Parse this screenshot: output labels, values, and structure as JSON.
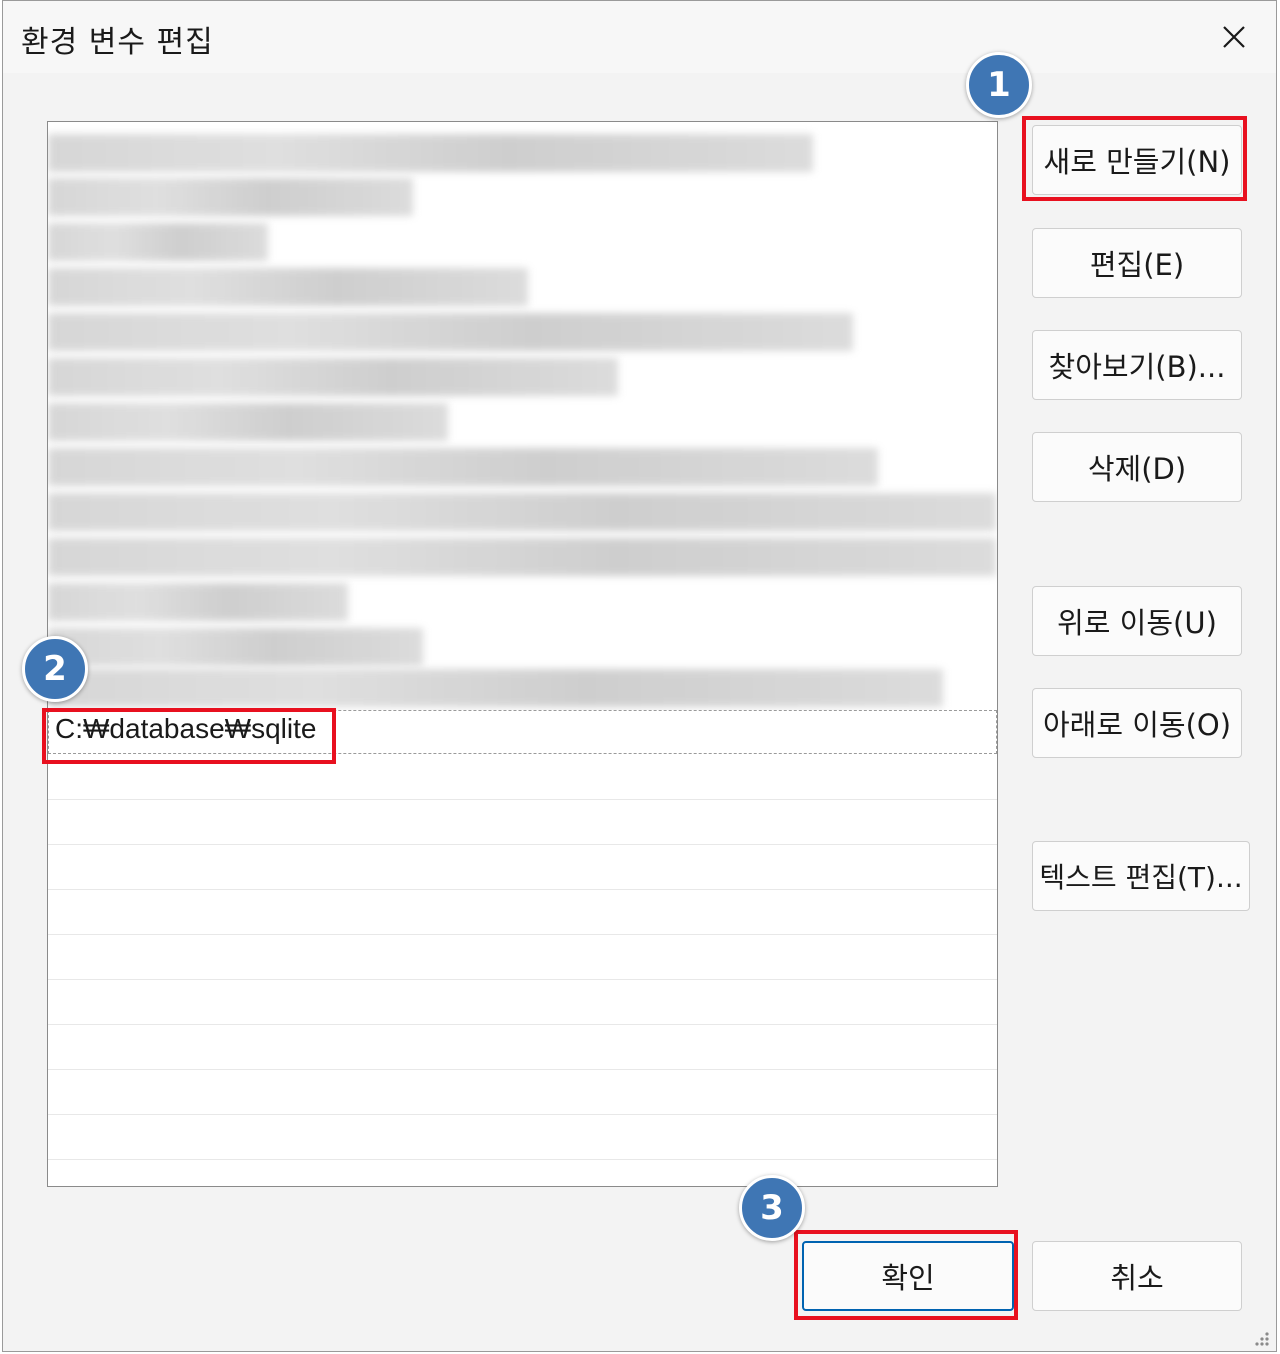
{
  "window": {
    "title": "환경 변수 편집"
  },
  "list": {
    "selected_value": "C:₩database₩sqlite"
  },
  "buttons": {
    "new": "새로 만들기(N)",
    "edit": "편집(E)",
    "browse": "찾아보기(B)...",
    "delete": "삭제(D)",
    "move_up": "위로 이동(U)",
    "move_down": "아래로 이동(O)",
    "edit_text": "텍스트 편집(T)...",
    "ok": "확인",
    "cancel": "취소"
  },
  "annotations": {
    "step1": "1",
    "step2": "2",
    "step3": "3",
    "highlight_color": "#e8101f",
    "badge_color": "#3f76b4"
  },
  "icons": {
    "close": "close-icon",
    "resize": "resize-grip-icon"
  }
}
